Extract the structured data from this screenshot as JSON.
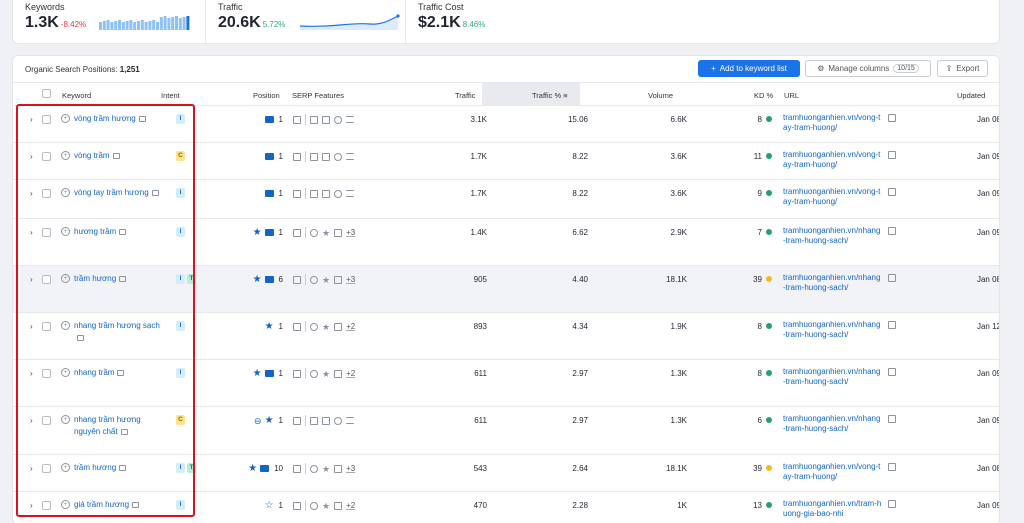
{
  "metrics": {
    "keywords": {
      "label": "Keywords",
      "value": "1.3K",
      "change": "-8.42%"
    },
    "traffic": {
      "label": "Traffic",
      "value": "20.6K",
      "change": "5.72%"
    },
    "traffic_cost": {
      "label": "Traffic Cost",
      "value": "$2.1K",
      "change": "8.46%"
    }
  },
  "table": {
    "title_prefix": "Organic Search Positions:",
    "title_count": "1,251",
    "add_button": "Add to keyword list",
    "manage_button": "Manage columns",
    "manage_badge": "10/15",
    "export_button": "Export",
    "columns": {
      "keyword": "Keyword",
      "intent": "Intent",
      "position": "Position",
      "serp": "SERP Features",
      "traffic": "Traffic",
      "traffic_pct": "Traffic %",
      "volume": "Volume",
      "kd": "KD %",
      "url": "URL",
      "updated": "Updated"
    },
    "rows": [
      {
        "keyword": "vòng trầm hương",
        "intent": [
          "I"
        ],
        "pos_icons": [
          "image"
        ],
        "position": "1",
        "more": "",
        "traffic": "3.1K",
        "traffic_pct": "15.06",
        "volume": "6.6K",
        "kd": "8",
        "kd_color": "#1fa36b",
        "url": "tramhuonganhien.vn/vong-tay-tram-huong/",
        "updated": "Jan 08",
        "height": 37
      },
      {
        "keyword": "vòng trầm",
        "intent": [
          "C"
        ],
        "pos_icons": [
          "image"
        ],
        "position": "1",
        "more": "",
        "traffic": "1.7K",
        "traffic_pct": "8.22",
        "volume": "3.6K",
        "kd": "11",
        "kd_color": "#1fa36b",
        "url": "tramhuonganhien.vn/vong-tay-tram-huong/",
        "updated": "Jan 09",
        "height": 37
      },
      {
        "keyword": "vòng tay trầm hương",
        "intent": [
          "I"
        ],
        "pos_icons": [
          "image"
        ],
        "position": "1",
        "more": "",
        "traffic": "1.7K",
        "traffic_pct": "8.22",
        "volume": "3.6K",
        "kd": "9",
        "kd_color": "#1fa36b",
        "url": "tramhuonganhien.vn/vong-tay-tram-huong/",
        "updated": "Jan 09",
        "height": 39
      },
      {
        "keyword": "hương trầm",
        "intent": [
          "I"
        ],
        "pos_icons": [
          "star",
          "image"
        ],
        "position": "1",
        "more": "+3",
        "traffic": "1.4K",
        "traffic_pct": "6.62",
        "volume": "2.9K",
        "kd": "7",
        "kd_color": "#1fa36b",
        "url": "tramhuonganhien.vn/nhang-tram-huong-sach/",
        "updated": "Jan 09",
        "height": 47
      },
      {
        "keyword": "trầm hương",
        "intent": [
          "I",
          "T"
        ],
        "pos_icons": [
          "star",
          "image"
        ],
        "position": "6",
        "more": "+3",
        "traffic": "905",
        "traffic_pct": "4.40",
        "volume": "18.1K",
        "kd": "39",
        "kd_color": "#f5b821",
        "url": "tramhuonganhien.vn/nhang-tram-huong-sach/",
        "updated": "Jan 08",
        "height": 47,
        "highlight": true
      },
      {
        "keyword": "nhang trầm hương sạch",
        "intent": [
          "I"
        ],
        "pos_icons": [
          "star"
        ],
        "position": "1",
        "more": "+2",
        "traffic": "893",
        "traffic_pct": "4.34",
        "volume": "1.9K",
        "kd": "8",
        "kd_color": "#1fa36b",
        "url": "tramhuonganhien.vn/nhang-tram-huong-sach/",
        "updated": "Jan 12",
        "height": 47
      },
      {
        "keyword": "nhang trầm",
        "intent": [
          "I"
        ],
        "pos_icons": [
          "star",
          "image"
        ],
        "position": "1",
        "more": "+2",
        "traffic": "611",
        "traffic_pct": "2.97",
        "volume": "1.3K",
        "kd": "8",
        "kd_color": "#1fa36b",
        "url": "tramhuonganhien.vn/nhang-tram-huong-sach/",
        "updated": "Jan 09",
        "height": 47
      },
      {
        "keyword": "nhang trầm hương nguyên chất",
        "intent": [
          "C"
        ],
        "pos_icons": [
          "link",
          "star"
        ],
        "position": "1",
        "more": "",
        "traffic": "611",
        "traffic_pct": "2.97",
        "volume": "1.3K",
        "kd": "6",
        "kd_color": "#1fa36b",
        "url": "tramhuonganhien.vn/nhang-tram-huong-sach/",
        "updated": "Jan 09",
        "height": 48
      },
      {
        "keyword": "trầm hương",
        "intent": [
          "I",
          "T"
        ],
        "pos_icons": [
          "star",
          "image"
        ],
        "position": "10",
        "more": "+3",
        "traffic": "543",
        "traffic_pct": "2.64",
        "volume": "18.1K",
        "kd": "39",
        "kd_color": "#f5b821",
        "url": "tramhuonganhien.vn/vong-tay-tram-huong/",
        "updated": "Jan 08",
        "height": 37
      },
      {
        "keyword": "giá trầm hương",
        "intent": [
          "I"
        ],
        "pos_icons": [
          "star-outline"
        ],
        "position": "1",
        "more": "+2",
        "traffic": "470",
        "traffic_pct": "2.28",
        "volume": "1K",
        "kd": "13",
        "kd_color": "#1fa36b",
        "url": "tramhuonganhien.vn/tram-huong-gia-bao-nhi",
        "updated": "Jan 09",
        "height": 37
      }
    ]
  }
}
